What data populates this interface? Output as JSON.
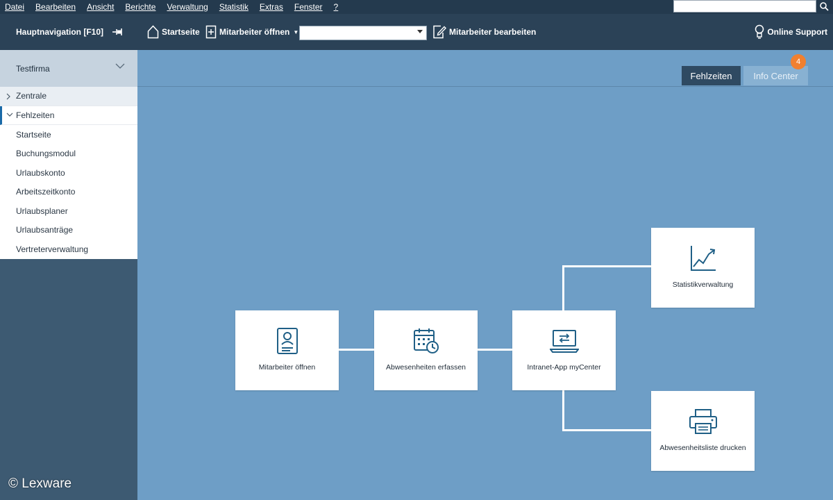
{
  "menubar": {
    "items": [
      "Datei",
      "Bearbeiten",
      "Ansicht",
      "Berichte",
      "Verwaltung",
      "Statistik",
      "Extras",
      "Fenster",
      "?"
    ],
    "search_value": ""
  },
  "toolbar": {
    "nav_label": "Hauptnavigation [F10]",
    "home_label": "Startseite",
    "open_employee_label": "Mitarbeiter öffnen",
    "employee_select_value": "",
    "edit_employee_label": "Mitarbeiter bearbeiten",
    "support_label": "Online Support"
  },
  "sidebar": {
    "company": "Testfirma",
    "groups": [
      {
        "label": "Zentrale",
        "expanded": false
      },
      {
        "label": "Fehlzeiten",
        "expanded": true
      }
    ],
    "items": [
      "Startseite",
      "Buchungsmodul",
      "Urlaubskonto",
      "Arbeitszeitkonto",
      "Urlaubsplaner",
      "Urlaubsanträge",
      "Vertreterverwaltung"
    ]
  },
  "tabs": {
    "fehlzeiten": "Fehlzeiten",
    "info_center": "Info Center",
    "info_badge": "4"
  },
  "flow": {
    "cards": {
      "open_employee": {
        "label": "Mitarbeiter öffnen",
        "icon": "employee-card-icon"
      },
      "absences": {
        "label": "Abwesenheiten erfassen",
        "icon": "calendar-clock-icon"
      },
      "intranet": {
        "label": "Intranet-App myCenter",
        "icon": "laptop-sync-icon"
      },
      "statistics": {
        "label": "Statistikverwaltung",
        "icon": "line-chart-icon"
      },
      "print": {
        "label": "Abwesenheitsliste drucken",
        "icon": "printer-icon"
      }
    }
  },
  "colors": {
    "accent": "#1a6aa8",
    "icon": "#1f5f86",
    "badge": "#f08030",
    "background": "#6e9ec6"
  },
  "copyright": "© Lexware"
}
